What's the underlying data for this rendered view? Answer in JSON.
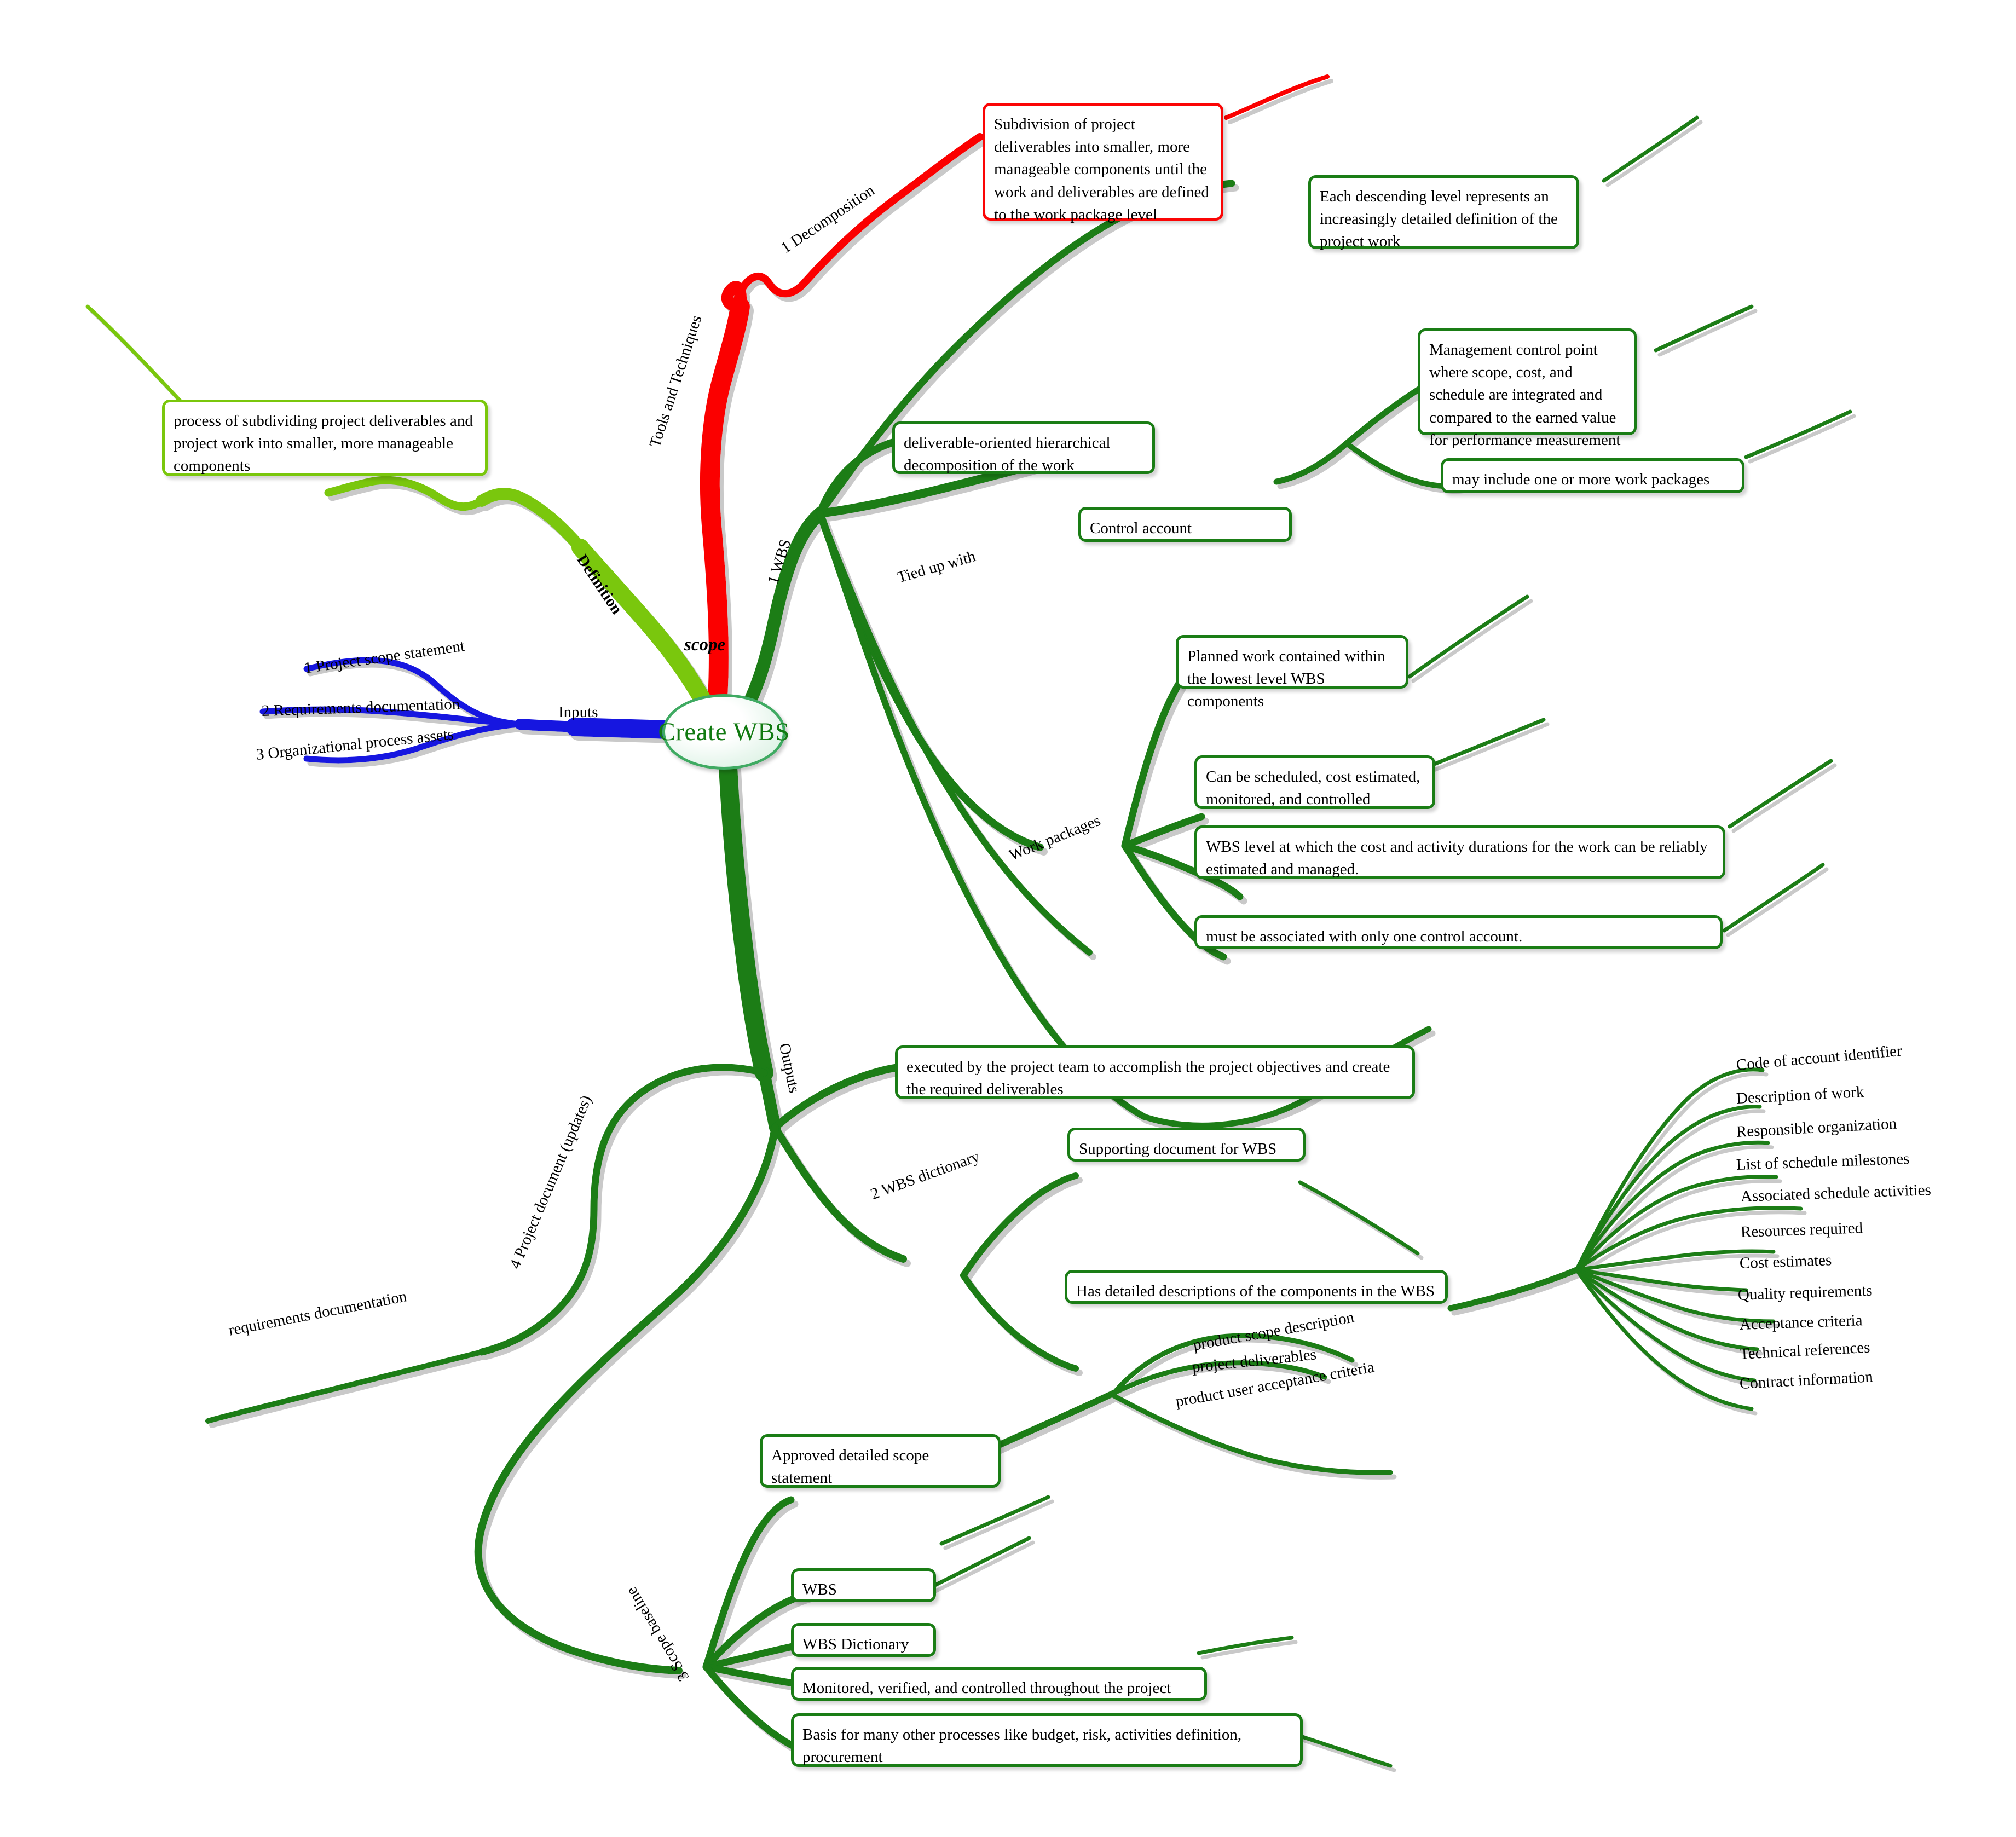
{
  "colors": {
    "dark_green": "#1a7d15",
    "light_green": "#7ac70c",
    "red": "#fb0505",
    "blue": "#1414e0",
    "node_text_green": "#117a11",
    "node_border": "#3faa62",
    "shadow_grey": "#cccccc"
  },
  "central": {
    "label": "Create WBS"
  },
  "center_labels": {
    "scope": "scope"
  },
  "branches": {
    "definition": {
      "label": "Definition",
      "color": "#7ac70c",
      "child": "process of subdividing project deliverables and project work into smaller, more manageable components"
    },
    "tools_and_techniques": {
      "label": "Tools and Techniques",
      "color": "#fb0505",
      "child_label": "1 Decomposition",
      "child_note": "Subdivision of project deliverables into smaller, more manageable components until the work and deliverables are defined to the work package level"
    },
    "inputs": {
      "label": "Inputs",
      "color": "#1414e0",
      "items": [
        "1 Project scope statement",
        "2 Requirements documentation",
        "3 Organizational process assets"
      ]
    },
    "outputs": {
      "label": "Outputs",
      "color": "#1a7d15"
    }
  },
  "wbs": {
    "label": "1 WBS",
    "notes": [
      "Each descending level represents an increasingly detailed definition of the project work",
      "deliverable-oriented hierarchical decomposition of the work"
    ],
    "tied_up_with": {
      "label": "Tied up with",
      "control_account": {
        "title": "Control account",
        "notes": [
          "Management control point where scope, cost, and schedule are integrated and compared to the earned value for performance measurement",
          "may include one or more work packages"
        ]
      }
    },
    "work_packages": {
      "label": "Work packages",
      "notes": [
        "Planned work contained within the lowest level WBS components",
        "Can be scheduled, cost estimated, monitored, and controlled",
        "WBS level at which the cost and activity durations for the work can be reliably estimated and managed.",
        "must be associated with only one control account."
      ]
    },
    "executed_note": "executed by the project team to accomplish the project objectives and create the required deliverables"
  },
  "wbs_dictionary": {
    "label": "2 WBS dictionary",
    "notes": [
      "Supporting document for WBS",
      "Has detailed descriptions of the components in the WBS"
    ],
    "detail_items": [
      "Code of account identifier",
      "Description of work",
      "Responsible organization",
      "List of schedule milestones",
      "Associated schedule activities",
      "Resources required",
      "Cost estimates",
      "Quality requirements",
      "Acceptance criteria",
      "Technical references",
      "Contract information"
    ]
  },
  "scope_baseline": {
    "label": "3 Scope baseline",
    "children": [
      "Approved detailed scope statement",
      "WBS",
      "WBS Dictionary",
      "Monitored, verified, and controlled throughout the project",
      "Basis for many other processes like budget, risk, activities definition, procurement"
    ],
    "scope_statement_items": [
      "product scope description",
      "project deliverables",
      "product user acceptance criteria"
    ]
  },
  "project_document_updates": {
    "label": "4 Project document (updates)",
    "child": "requirements documentation"
  }
}
